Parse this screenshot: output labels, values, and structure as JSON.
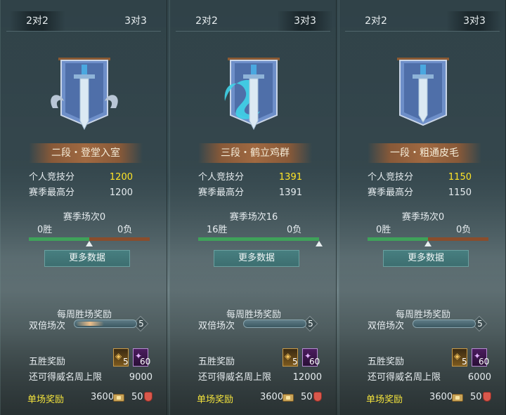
{
  "panels": [
    {
      "tabs": [
        "2对2",
        "3对3"
      ],
      "active_tab": 0,
      "rank": "二段・登堂入室",
      "personal_label": "个人竞技分",
      "personal_value": "1200",
      "season_high_label": "赛季最高分",
      "season_high_value": "1200",
      "season_count": "赛季场次0",
      "wins": "0胜",
      "losses": "0负",
      "win_ratio": 0.5,
      "more_button": "更多数据",
      "weekly_title": "每周胜场奖励",
      "double_label": "双倍场次",
      "double_cap": "5",
      "five_win_label": "五胜奖励",
      "reward1_count": "5",
      "reward2_count": "60",
      "cap_label": "还可得威名周上限",
      "cap_value": "9000",
      "single_label": "单场奖励",
      "single_value1": "3600",
      "single_value2": "50",
      "emblem": "banner-sword-silver"
    },
    {
      "tabs": [
        "2对2",
        "3对3"
      ],
      "active_tab": 1,
      "rank": "三段・鹤立鸡群",
      "personal_label": "个人竞技分",
      "personal_value": "1391",
      "season_high_label": "赛季最高分",
      "season_high_value": "1391",
      "season_count": "赛季场次16",
      "wins": "16胜",
      "losses": "0负",
      "win_ratio": 1.0,
      "more_button": "更多数据",
      "weekly_title": "每周胜场奖励",
      "double_label": "双倍场次",
      "double_cap": "5",
      "five_win_label": "五胜奖励",
      "reward1_count": "5",
      "reward2_count": "60",
      "cap_label": "还可得威名周上限",
      "cap_value": "12000",
      "single_label": "单场奖励",
      "single_value1": "3600",
      "single_value2": "50",
      "emblem": "banner-sword-dragon"
    },
    {
      "tabs": [
        "2对2",
        "3对3"
      ],
      "active_tab": 1,
      "rank": "一段・粗通皮毛",
      "personal_label": "个人竞技分",
      "personal_value": "1150",
      "season_high_label": "赛季最高分",
      "season_high_value": "1150",
      "season_count": "赛季场次0",
      "wins": "0胜",
      "losses": "0负",
      "win_ratio": 0.5,
      "more_button": "更多数据",
      "weekly_title": "每周胜场奖励",
      "double_label": "双倍场次",
      "double_cap": "5",
      "five_win_label": "五胜奖励",
      "reward1_count": "5",
      "reward2_count": "60",
      "cap_label": "还可得威名周上限",
      "cap_value": "6000",
      "single_label": "单场奖励",
      "single_value1": "3600",
      "single_value2": "50",
      "emblem": "banner-sword-plain"
    }
  ],
  "colors": {
    "highlight_score": "#ffe426",
    "win_bar": "#3fa25a",
    "loss_bar": "#8a4d2c",
    "rank_band": "#a06941",
    "single_reward_label": "#f3e33c"
  }
}
